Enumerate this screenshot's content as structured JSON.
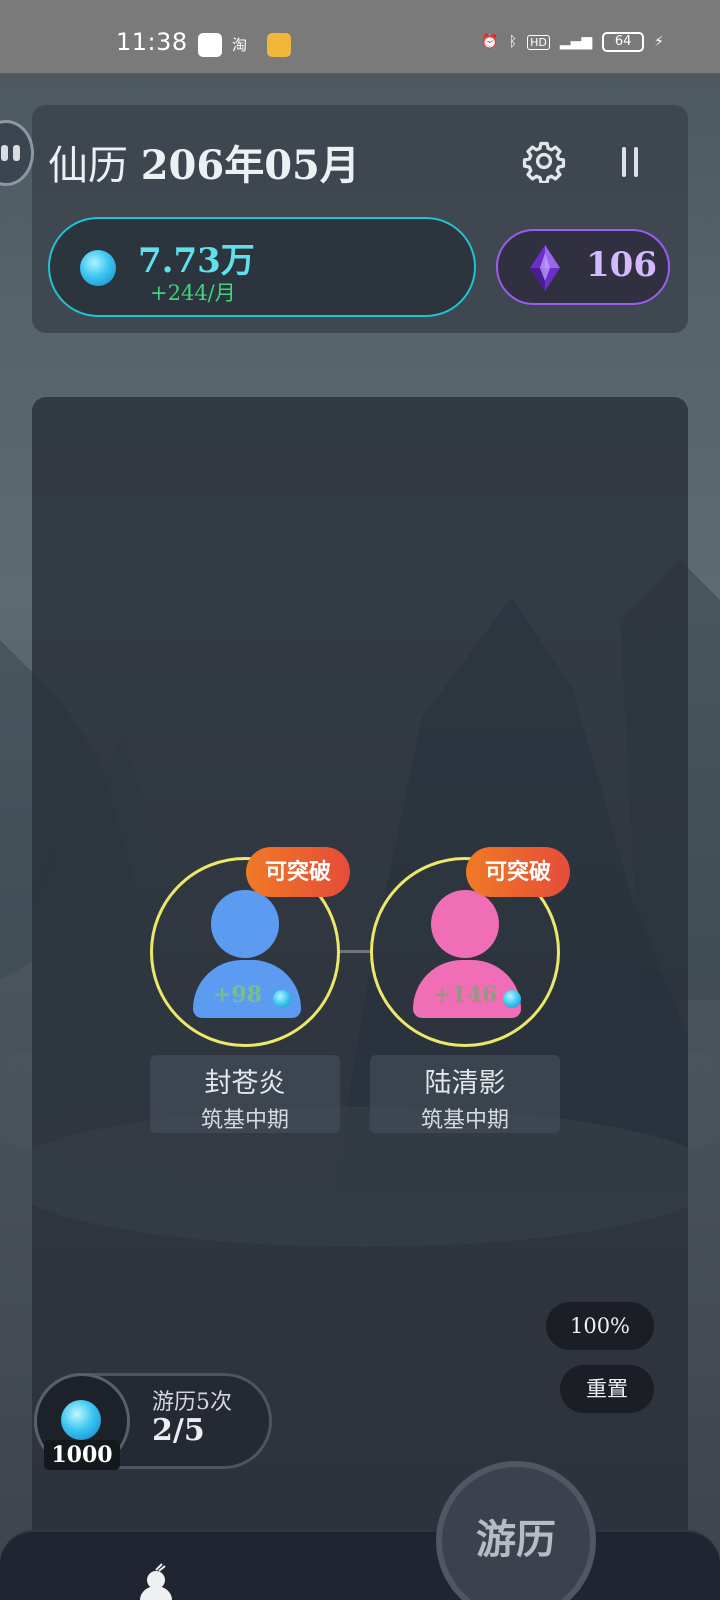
{
  "status_bar": {
    "time": "11:38",
    "battery": "64"
  },
  "header": {
    "calendar_prefix": "仙历",
    "calendar_date": "206年05月",
    "settings_icon": "gear-icon",
    "pause_icon": "pause-icon"
  },
  "resources": {
    "spirit_stone": {
      "amount": "7.73万",
      "rate": "+244/月",
      "icon": "spirit-stone-icon",
      "color": "#20c2d6"
    },
    "crystal": {
      "amount": "106",
      "icon": "purple-crystal-icon",
      "color": "#9b5cf0"
    }
  },
  "disciples": [
    {
      "name": "封苍炎",
      "rank": "筑基中期",
      "gain": "+98",
      "badge": "可突破",
      "avatar_color": "#5b9cf2"
    },
    {
      "name": "陆清影",
      "rank": "筑基中期",
      "gain": "+146",
      "badge": "可突破",
      "avatar_color": "#ef6eb6"
    }
  ],
  "controls": {
    "zoom": "100%",
    "reset": "重置"
  },
  "travel": {
    "cost": "1000",
    "label": "游历5次",
    "count": "2/5",
    "button": "游历"
  }
}
